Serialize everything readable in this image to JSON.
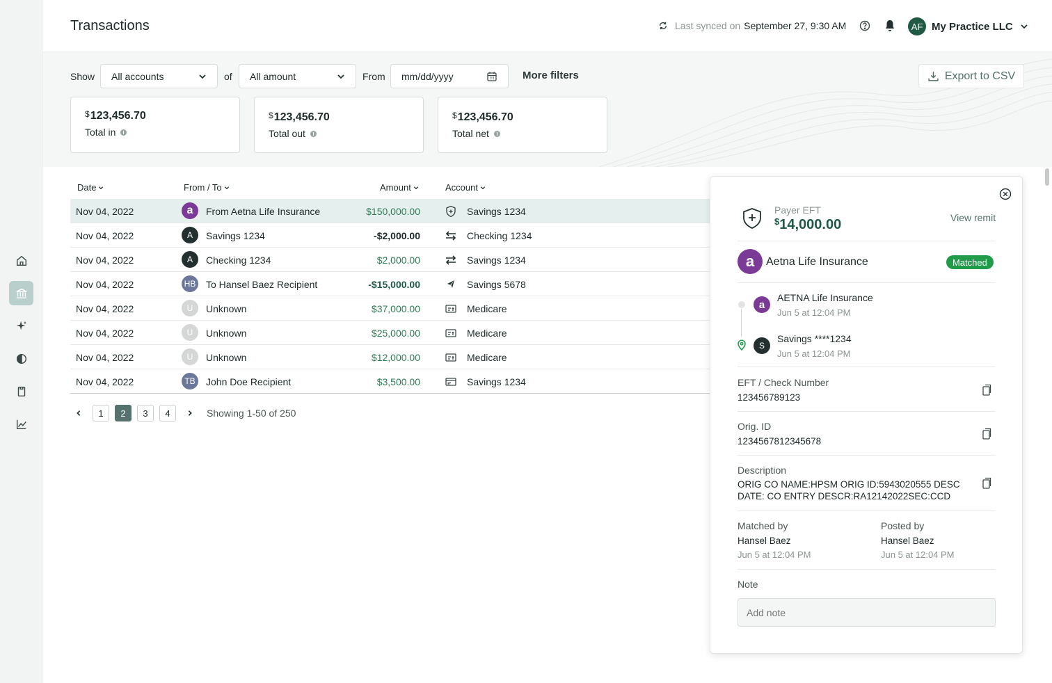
{
  "header": {
    "title": "Transactions",
    "sync_label": "Last synced on",
    "sync_time": "September 27, 9:30 AM",
    "user_initials": "AF",
    "practice_name": "My Practice LLC"
  },
  "filters": {
    "show_label": "Show",
    "accounts_value": "All accounts",
    "of_label": "of",
    "amount_value": "All amount",
    "from_label": "From",
    "date_placeholder": "mm/dd/yyyy",
    "more_filters": "More filters",
    "export": "Export to CSV"
  },
  "stats": [
    {
      "currency": "$",
      "value": "123,456.70",
      "label": "Total in"
    },
    {
      "currency": "$",
      "value": "123,456.70",
      "label": "Total out"
    },
    {
      "currency": "$",
      "value": "123,456.70",
      "label": "Total net"
    }
  ],
  "table": {
    "columns": {
      "date": "Date",
      "from_to": "From / To",
      "amount": "Amount",
      "account": "Account"
    },
    "rows": [
      {
        "date": "Nov 04, 2022",
        "avatar": "a",
        "party": "From Aetna Life Insurance",
        "amount": "$150,000.00",
        "account": "Savings 1234",
        "icon": "shield-icon"
      },
      {
        "date": "Nov 04, 2022",
        "avatar": "A",
        "party": "Savings 1234",
        "amount": "-$2,000.00",
        "account": "Checking 1234",
        "icon": "transfer-left-icon"
      },
      {
        "date": "Nov 04, 2022",
        "avatar": "A",
        "party": "Checking 1234",
        "amount": "$2,000.00",
        "account": "Savings 1234",
        "icon": "transfer-right-icon"
      },
      {
        "date": "Nov 04, 2022",
        "avatar": "HB",
        "party": "To Hansel Baez Recipient",
        "amount": "-$15,000.00",
        "account": "Savings 5678",
        "icon": "send-icon"
      },
      {
        "date": "Nov 04, 2022",
        "avatar": "U",
        "party": "Unknown",
        "amount": "$37,000.00",
        "account": "Medicare",
        "icon": "check-icon"
      },
      {
        "date": "Nov 04, 2022",
        "avatar": "U",
        "party": "Unknown",
        "amount": "$25,000.00",
        "account": "Medicare",
        "icon": "check-icon"
      },
      {
        "date": "Nov 04, 2022",
        "avatar": "U",
        "party": "Unknown",
        "amount": "$12,000.00",
        "account": "Medicare",
        "icon": "check-icon"
      },
      {
        "date": "Nov 04, 2022",
        "avatar": "TB",
        "party": "John Doe Recipient",
        "amount": "$3,500.00",
        "account": "Savings 1234",
        "icon": "card-icon"
      }
    ]
  },
  "pagination": {
    "pages": [
      "1",
      "2",
      "3",
      "4"
    ],
    "active": "2",
    "info": "Showing 1-50 of 250"
  },
  "panel": {
    "type_label": "Payer EFT",
    "currency": "$",
    "amount": "14,000.00",
    "view_remit": "View remit",
    "payer_initial": "a",
    "payer_name": "Aetna Life Insurance",
    "status": "Matched",
    "timeline": [
      {
        "initial": "a",
        "title": "AETNA Life Insurance",
        "time": "Jun 5 at 12:04 PM"
      },
      {
        "initial": "S",
        "title": "Savings ****1234",
        "time": "Jun 5 at 12:04 PM"
      }
    ],
    "eft_label": "EFT / Check Number",
    "eft_value": "123456789123",
    "orig_label": "Orig. ID",
    "orig_value": "1234567812345678",
    "desc_label": "Description",
    "desc_line1": "ORIG CO NAME:HPSM ORIG ID:5943020555 DESC",
    "desc_line2": "DATE: CO ENTRY DESCR:RA12142022SEC:CCD",
    "matched_by_label": "Matched by",
    "matched_by_name": "Hansel Baez",
    "matched_by_time": "Jun 5 at 12:04 PM",
    "posted_by_label": "Posted by",
    "posted_by_name": "Hansel Baez",
    "posted_by_time": "Jun 5 at 12:04 PM",
    "note_label": "Note",
    "note_placeholder": "Add note"
  },
  "colors": {
    "brand_green": "#1e5a44",
    "positive": "#2d7a55",
    "matched": "#1f9b4a",
    "aetna_purple": "#7a3a96",
    "sidebar_active": "#b9cfcc"
  }
}
